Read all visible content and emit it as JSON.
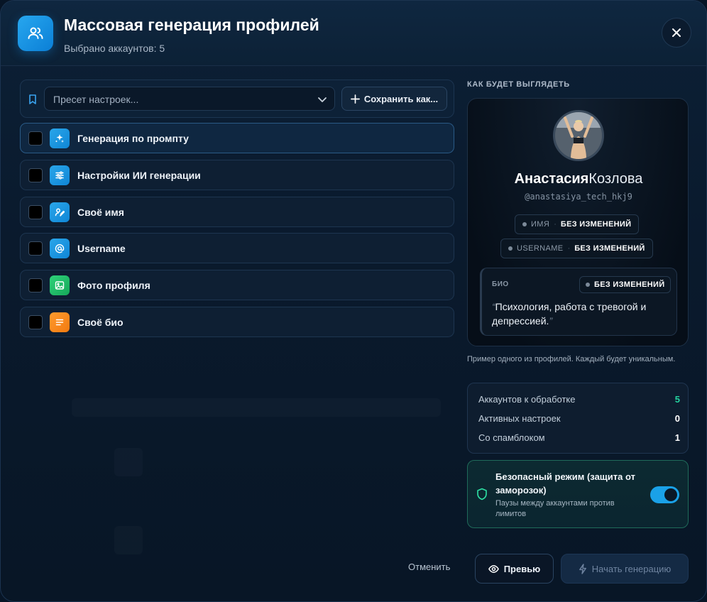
{
  "header": {
    "title": "Массовая генерация профилей",
    "subtitle": "Выбрано аккаунтов: 5"
  },
  "preset": {
    "placeholder": "Пресет настроек...",
    "save_label": "Сохранить как..."
  },
  "options": [
    {
      "label": "Генерация по промпту",
      "icon": "sparkle-icon",
      "checked": false,
      "active": true
    },
    {
      "label": "Настройки ИИ генерации",
      "icon": "sliders-icon",
      "checked": false,
      "active": false
    },
    {
      "label": "Своё имя",
      "icon": "signature-icon",
      "checked": false,
      "active": false
    },
    {
      "label": "Username",
      "icon": "at-icon",
      "checked": false,
      "active": false
    },
    {
      "label": "Фото профиля",
      "icon": "image-icon",
      "checked": false,
      "active": false
    },
    {
      "label": "Своё био",
      "icon": "text-lines-icon",
      "checked": false,
      "active": false
    }
  ],
  "preview": {
    "heading": "КАК БУДЕТ ВЫГЛЯДЕТЬ",
    "first_name": "Анастасия",
    "last_name": "Козлова",
    "handle": "@anastasiya_tech_hkj9",
    "name_field": {
      "key": "ИМЯ",
      "value": "БЕЗ ИЗМЕНЕНИЙ"
    },
    "username_field": {
      "key": "USERNAME",
      "value": "БЕЗ ИЗМЕНЕНИЙ"
    },
    "bio": {
      "label": "БИО",
      "status": "БЕЗ ИЗМЕНЕНИЙ",
      "text": "Психология, работа с тревогой и депрессией."
    },
    "note": "Пример одного из профилей. Каждый будет уникальным."
  },
  "stats": [
    {
      "label": "Аккаунтов к обработке",
      "value": "5",
      "color": "#24d3a0"
    },
    {
      "label": "Активных настроек",
      "value": "0",
      "color": "#ffffff"
    },
    {
      "label": "Со спамблоком",
      "value": "1",
      "color": "#ffffff"
    }
  ],
  "safe_mode": {
    "title": "Безопасный режим (защита от заморозок)",
    "subtitle": "Паузы между аккаунтами против лимитов",
    "enabled": true
  },
  "footer": {
    "cancel_label": "Отменить",
    "preview_label": "Превью",
    "start_label": "Начать генерацию"
  },
  "colors": {
    "accent": "#1aa1e8",
    "success": "#24d3a0"
  }
}
